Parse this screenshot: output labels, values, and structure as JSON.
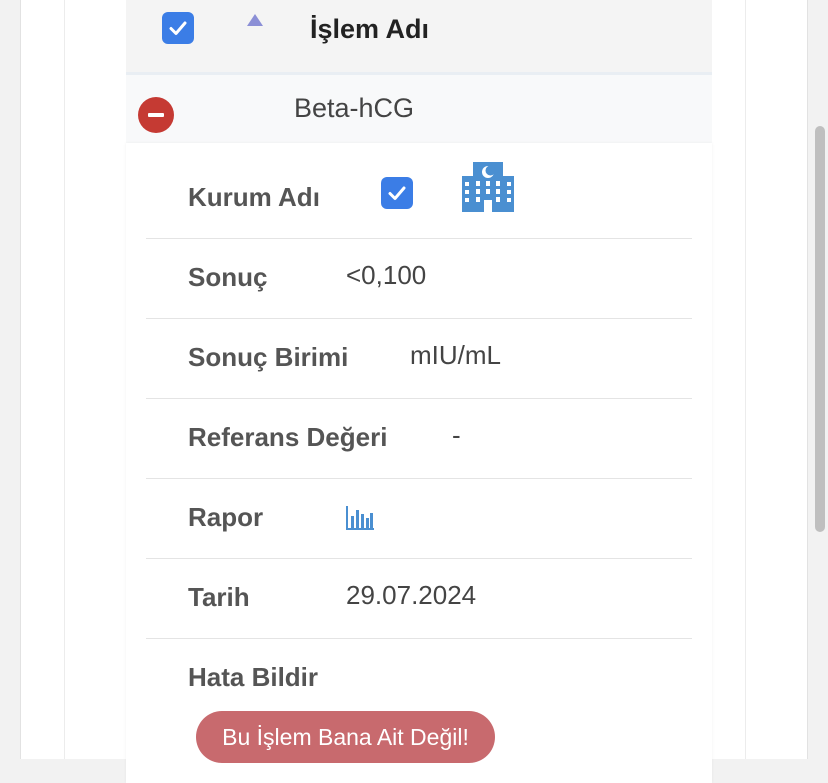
{
  "header": {
    "title": "İşlem Adı",
    "select_all_checked": true,
    "sort_icon": "sort-up-icon"
  },
  "row": {
    "title": "Beta-hCG",
    "collapse_icon": "minus-circle-icon"
  },
  "details": {
    "institution": {
      "label": "Kurum Adı",
      "checked": true,
      "icon": "hospital-building-icon"
    },
    "result": {
      "label": "Sonuç",
      "value": "<0,100"
    },
    "unit": {
      "label": "Sonuç Birimi",
      "value": "mIU/mL"
    },
    "reference": {
      "label": "Referans Değeri",
      "value": "-"
    },
    "report": {
      "label": "Rapor",
      "icon": "bar-chart-icon"
    },
    "date": {
      "label": "Tarih",
      "value": "29.07.2024"
    },
    "error": {
      "label": "Hata Bildir",
      "button_label": "Bu İşlem Bana Ait Değil!"
    }
  },
  "colors": {
    "checkbox": "#3b7de6",
    "collapse": "#c53a33",
    "report_button": "#c86a6e",
    "icon_blue": "#4a8fd1"
  }
}
